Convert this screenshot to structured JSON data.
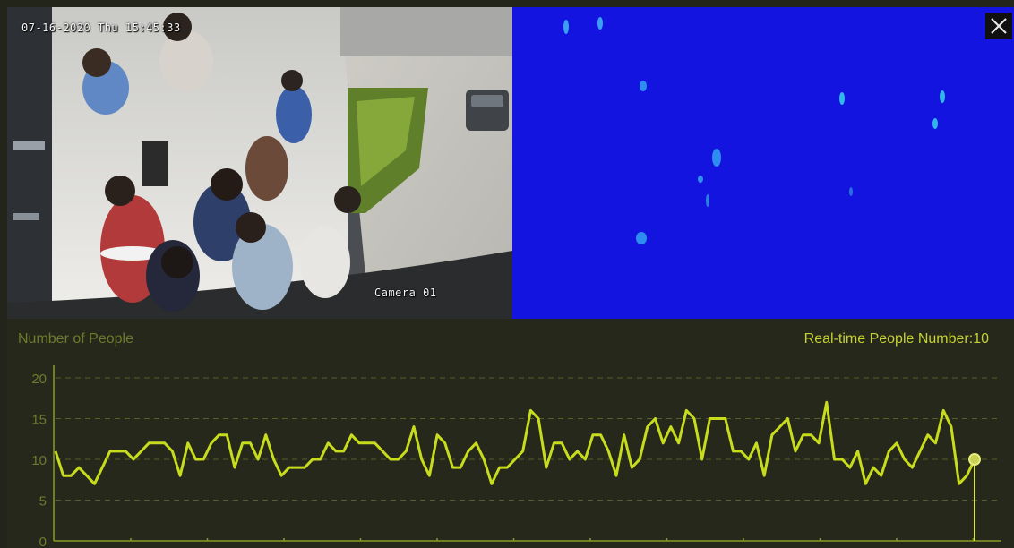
{
  "video": {
    "timestamp": "07-16-2020 Thu 15:45:33",
    "camera_label": "Camera 01"
  },
  "window": {
    "close_icon": "close-icon"
  },
  "chart_data": {
    "type": "line",
    "title": "Number of People",
    "realtime_label": "Real-time People Number:10",
    "ylim": [
      0,
      20
    ],
    "yticks": [
      "0",
      "5",
      "10",
      "15",
      "20"
    ],
    "grid": true,
    "line_color": "#c8dc1e",
    "series": [
      {
        "values": [
          11,
          8,
          8,
          9,
          8,
          7,
          9,
          11,
          11,
          11,
          10,
          11,
          12,
          12,
          12,
          11,
          8,
          12,
          10,
          10,
          12,
          13,
          13,
          9,
          12,
          12,
          10,
          13,
          10,
          8,
          9,
          9,
          9,
          10,
          10,
          12,
          11,
          11,
          13,
          12,
          12,
          12,
          11,
          10,
          10,
          11,
          14,
          10,
          8,
          13,
          12,
          9,
          9,
          11,
          12,
          10,
          7,
          9,
          9,
          10,
          11,
          16,
          15,
          9,
          12,
          12,
          10,
          11,
          10,
          13,
          13,
          11,
          8,
          13,
          9,
          10,
          14,
          15,
          12,
          14,
          12,
          16,
          15,
          10,
          15,
          15,
          15,
          11,
          11,
          10,
          12,
          8,
          13,
          14,
          15,
          11,
          13,
          13,
          12,
          17,
          10,
          10,
          9,
          11,
          7,
          9,
          8,
          11,
          12,
          10,
          9,
          11,
          13,
          12,
          16,
          14,
          7,
          8,
          10
        ]
      }
    ],
    "current_value": 10
  }
}
